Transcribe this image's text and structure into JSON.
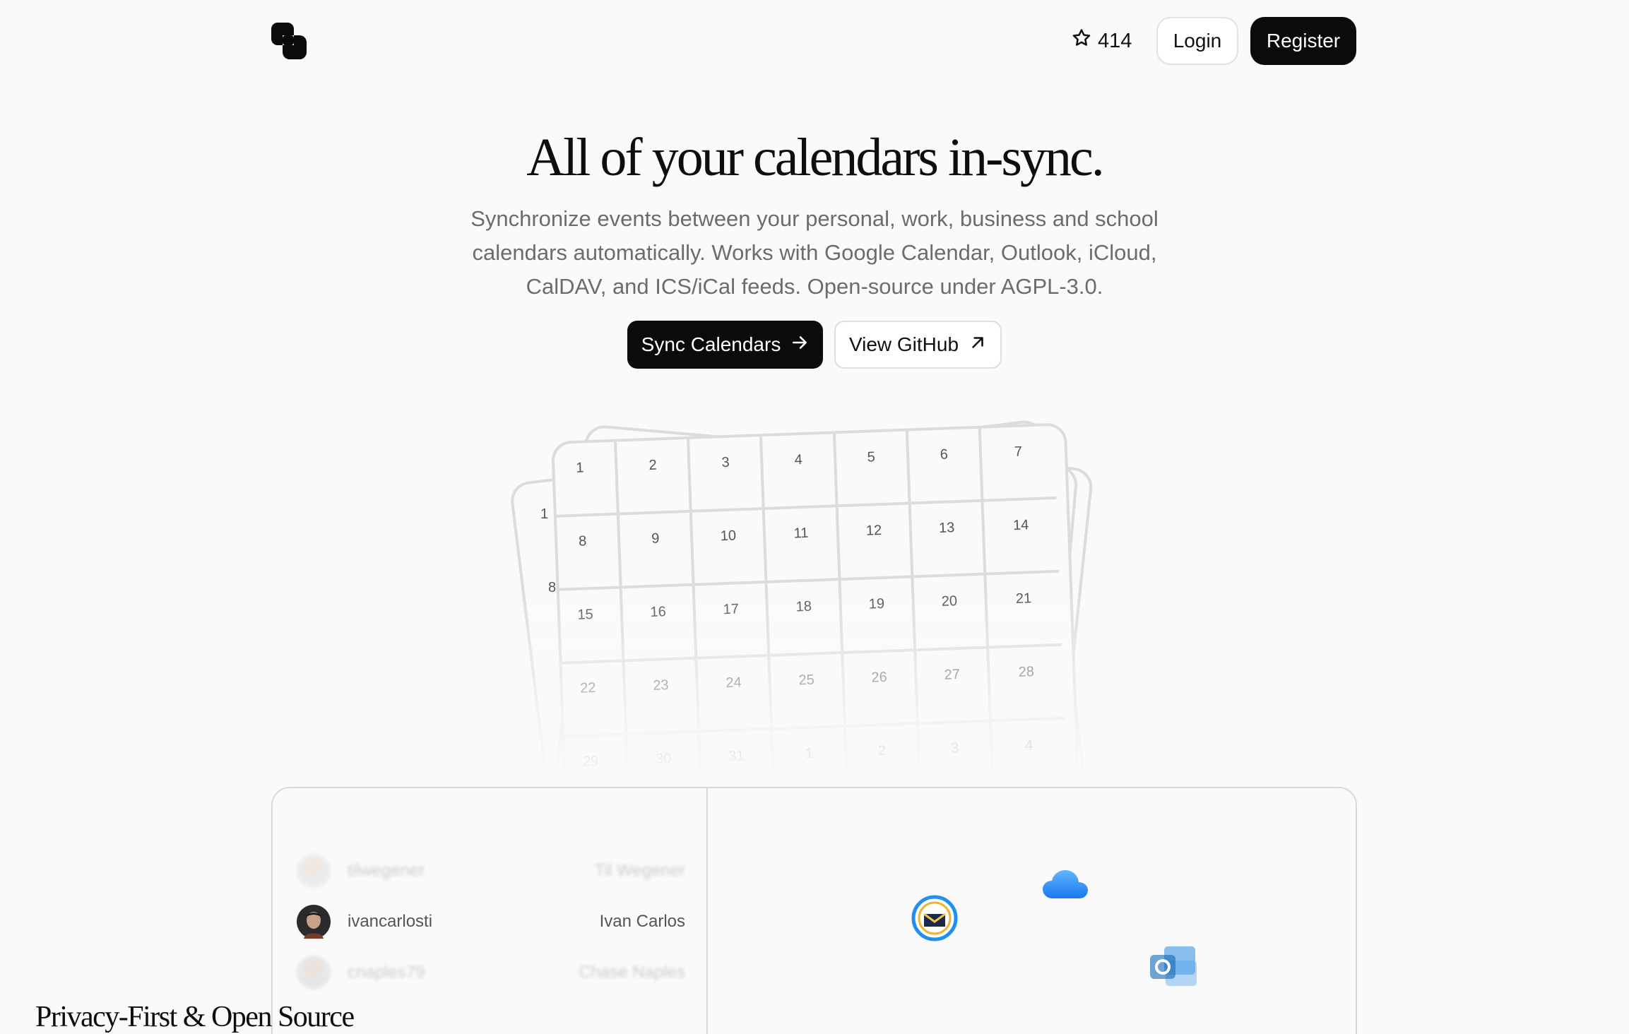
{
  "header": {
    "logo_name": "logo-icon",
    "star_count": "414",
    "login_label": "Login",
    "register_label": "Register"
  },
  "hero": {
    "title": "All of your calendars in-sync.",
    "subtitle": "Synchronize events between your personal, work, business and school calendars automatically. Works with Google Calendar, Outlook, iCloud, CalDAV, and ICS/iCal feeds. Open-source under AGPL-3.0.",
    "primary_cta": "Sync Calendars",
    "secondary_cta": "View GitHub"
  },
  "calendar": {
    "days": [
      "1",
      "2",
      "3",
      "4",
      "5",
      "6",
      "7",
      "8",
      "9",
      "10",
      "11",
      "12",
      "13",
      "14",
      "15",
      "16",
      "17",
      "18",
      "19",
      "20",
      "21",
      "22",
      "23",
      "24",
      "25",
      "26",
      "27",
      "28",
      "29",
      "30",
      "31",
      "1",
      "2",
      "3",
      "4"
    ],
    "back_numbers": [
      "1",
      "1",
      "8"
    ]
  },
  "contributors": [
    {
      "handle": "tilwegener",
      "name": "Til Wegener"
    },
    {
      "handle": "ivancarlosti",
      "name": "Ivan Carlos"
    },
    {
      "handle": "cnaples79",
      "name": "Chase Naples"
    }
  ],
  "feature": {
    "heading": "Privacy-First & Open Source"
  },
  "providers": [
    "thunderbird-icon",
    "icloud-icon",
    "outlook-icon"
  ],
  "colors": {
    "background": "#fafafa",
    "primary": "#0b0b0b",
    "border": "#d9d9d9",
    "icloud_blue": "#3a8ff5",
    "outlook_blue": "#0f6cbd"
  }
}
